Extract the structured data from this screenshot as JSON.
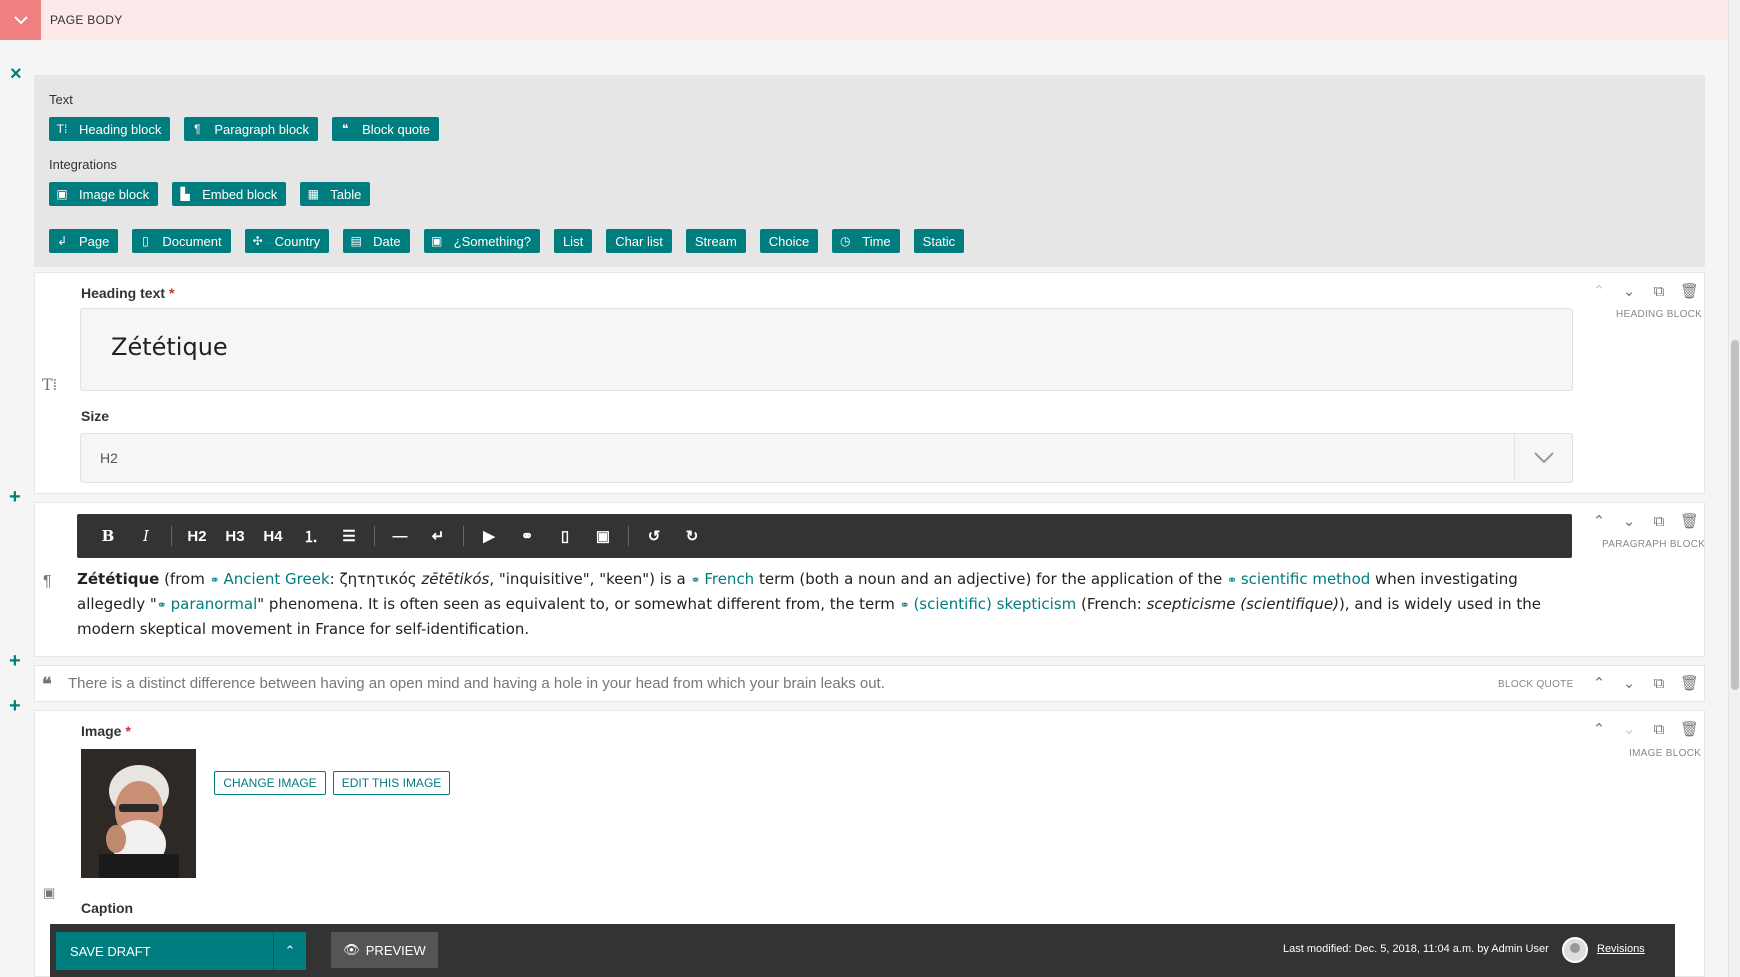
{
  "header": {
    "title": "PAGE BODY"
  },
  "chooser": {
    "groups": [
      {
        "label": "Text",
        "buttons": [
          {
            "label": "Heading block",
            "icon": "heading-icon"
          },
          {
            "label": "Paragraph block",
            "icon": "pilcrow-icon"
          },
          {
            "label": "Block quote",
            "icon": "quote-icon"
          }
        ]
      },
      {
        "label": "Integrations",
        "buttons": [
          {
            "label": "Image block",
            "icon": "image-icon"
          },
          {
            "label": "Embed block",
            "icon": "media-icon"
          },
          {
            "label": "Table",
            "icon": "table-icon"
          }
        ]
      },
      {
        "label": "",
        "buttons": [
          {
            "label": "Page",
            "icon": "link-page-icon"
          },
          {
            "label": "Document",
            "icon": "document-icon"
          },
          {
            "label": "Country",
            "icon": "globe-icon"
          },
          {
            "label": "Date",
            "icon": "calendar-icon"
          },
          {
            "label": "¿Something?",
            "icon": "image-icon"
          },
          {
            "label": "List",
            "icon": ""
          },
          {
            "label": "Char list",
            "icon": ""
          },
          {
            "label": "Stream",
            "icon": ""
          },
          {
            "label": "Choice",
            "icon": ""
          },
          {
            "label": "Time",
            "icon": "clock-icon"
          },
          {
            "label": "Static",
            "icon": ""
          }
        ]
      }
    ]
  },
  "heading_block": {
    "kind": "HEADING BLOCK",
    "text_label": "Heading text",
    "required_mark": "*",
    "value": "Zététique",
    "size_label": "Size",
    "size_value": "H2"
  },
  "paragraph_block": {
    "kind": "PARAGRAPH BLOCK",
    "toolbar": [
      "B",
      "I",
      "H2",
      "H3",
      "H4",
      "ordered-list-icon",
      "bulleted-list-icon",
      "hr-icon",
      "line-break-icon",
      "embed-icon",
      "link-icon",
      "document-icon",
      "image-icon",
      "undo-icon",
      "redo-icon"
    ],
    "t1": "Zététique",
    "t2": " (from ",
    "l1": "Ancient Greek",
    "t3": ": ζητητικός ",
    "t4": "zētētikós",
    "t5": ", \"inquisitive\", \"keen\") is a ",
    "l2": "French",
    "t6": " term (both a noun and an adjective) for the application of the ",
    "l3": "scientific method",
    "t7": " when investigating allegedly \"",
    "l4": "paranormal",
    "t8": "\" phenomena. It is often seen as equivalent to, or somewhat different from, the term ",
    "l5": "(scientific) skepticism",
    "t9": " (French: ",
    "t10": "scepticisme (scientifique)",
    "t11": "), and is widely used in the modern skeptical movement in France for self-identification."
  },
  "quote_block": {
    "kind": "BLOCK QUOTE",
    "text": "There is a distinct difference between having an open mind and having a hole in your head from which your brain leaks out."
  },
  "image_block": {
    "kind": "IMAGE BLOCK",
    "label": "Image",
    "required_mark": "*",
    "change_label": "CHANGE IMAGE",
    "edit_label": "EDIT THIS IMAGE",
    "caption_label": "Caption"
  },
  "footer": {
    "save_label": "SAVE DRAFT",
    "preview_label": "PREVIEW",
    "last_modified": "Last modified: Dec. 5, 2018, 11:04 a.m. by Admin User",
    "revisions_label": "Revisions"
  },
  "colors": {
    "accent": "#007d7e",
    "header_bg": "#fde9e9",
    "header_toggle": "#f08080",
    "toolbar_bg": "#333333",
    "required": "#cd3238"
  }
}
